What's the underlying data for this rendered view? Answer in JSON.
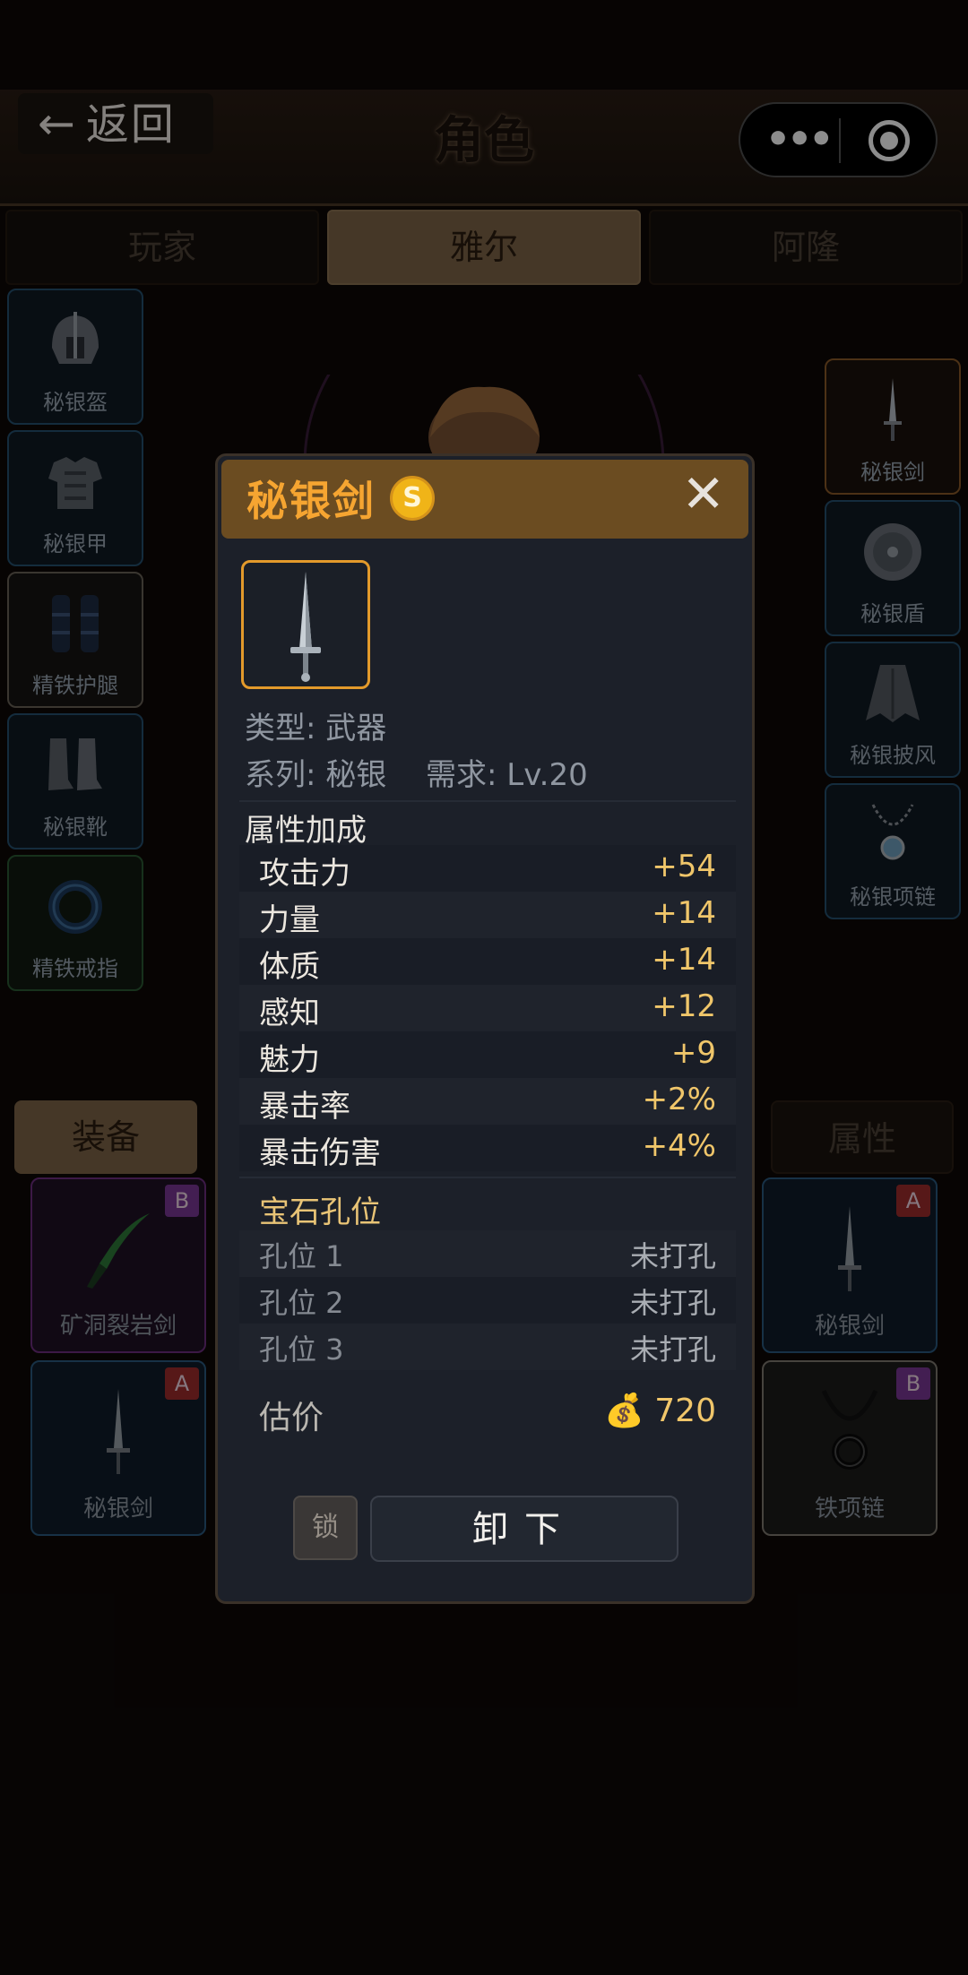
{
  "header": {
    "back_label": "返回",
    "back_arrow": "←",
    "title": "角色"
  },
  "character_tabs": [
    "玩家",
    "雅尔",
    "阿隆"
  ],
  "active_character": "雅尔",
  "equipment_left": [
    {
      "name": "秘银盔",
      "icon": "helmet-icon"
    },
    {
      "name": "秘银甲",
      "icon": "armor-icon"
    },
    {
      "name": "精铁护腿",
      "icon": "greaves-icon"
    },
    {
      "name": "秘银靴",
      "icon": "boots-icon"
    },
    {
      "name": "精铁戒指",
      "icon": "ring-icon"
    }
  ],
  "equipment_right": [
    {
      "name": "秘银剑",
      "icon": "sword-icon"
    },
    {
      "name": "秘银盾",
      "icon": "shield-icon"
    },
    {
      "name": "秘银披风",
      "icon": "cloak-icon"
    },
    {
      "name": "秘银项链",
      "icon": "necklace-icon"
    }
  ],
  "bottom_tabs": {
    "equip": "装备",
    "attributes": "属性"
  },
  "inventory": [
    {
      "name": "矿洞裂岩剑",
      "grade": "B",
      "icon": "green-sword-icon"
    },
    {
      "name": "秘银剑",
      "grade": "A",
      "icon": "sword-icon"
    },
    {
      "name": "秘银剑",
      "grade": "A",
      "icon": "sword-icon"
    },
    {
      "name": "铁项链",
      "grade": "B",
      "icon": "iron-necklace-icon"
    }
  ],
  "modal": {
    "title": "秘银剑",
    "coin_badge": "S",
    "close": "✕",
    "type_line": "类型: 武器",
    "series_line": "系列: 秘银",
    "requirement_line": "需求: Lv.20",
    "attributes_title": "属性加成",
    "attributes": [
      {
        "name": "攻击力",
        "value": "+54"
      },
      {
        "name": "力量",
        "value": "+14"
      },
      {
        "name": "体质",
        "value": "+14"
      },
      {
        "name": "感知",
        "value": "+12"
      },
      {
        "name": "魅力",
        "value": "+9"
      },
      {
        "name": "暴击率",
        "value": "+2%"
      },
      {
        "name": "暴击伤害",
        "value": "+4%"
      }
    ],
    "gem_title": "宝石孔位",
    "gem_slots": [
      {
        "name": "孔位 1",
        "status": "未打孔"
      },
      {
        "name": "孔位 2",
        "status": "未打孔"
      },
      {
        "name": "孔位 3",
        "status": "未打孔"
      }
    ],
    "price_label": "估价",
    "price_icon": "💰",
    "price_value": "720",
    "lock_label": "锁",
    "unequip_label": "卸下"
  },
  "colors": {
    "background": "#0d0907",
    "gold_tab": "#7f6547",
    "modal_bg": "#1c2029",
    "title_orange": "#f6a531",
    "stat_value": "#f0c66a"
  }
}
